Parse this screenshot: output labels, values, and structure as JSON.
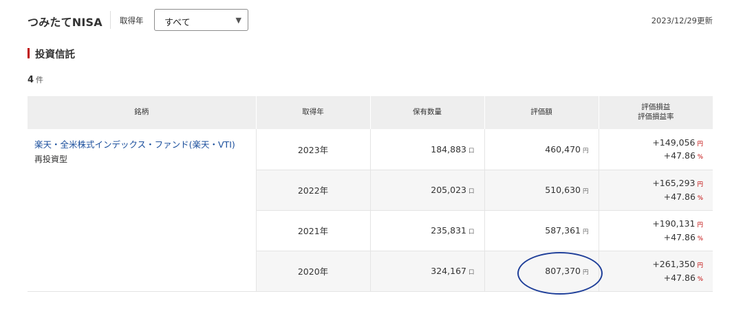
{
  "header": {
    "title": "つみたてNISA",
    "year_label": "取得年",
    "year_select": {
      "value": "すべて",
      "arrow": "▼"
    },
    "updated": "2023/12/29更新"
  },
  "section": {
    "title": "投資信託"
  },
  "count": {
    "value": "4",
    "unit": "件"
  },
  "table": {
    "columns": [
      "銘柄",
      "取得年",
      "保有数量",
      "評価額",
      "評価損益",
      "評価損益率"
    ],
    "fund": {
      "name": "楽天・全米株式インデックス・ファンド(楽天・VTI)",
      "type": "再投資型"
    },
    "units": {
      "quantity": "口",
      "yen": "円",
      "percent": "%"
    },
    "rows": [
      {
        "year": "2023年",
        "quantity": "184,883",
        "value": "460,470",
        "gain": "+149,056",
        "rate": "+47.86"
      },
      {
        "year": "2022年",
        "quantity": "205,023",
        "value": "510,630",
        "gain": "+165,293",
        "rate": "+47.86"
      },
      {
        "year": "2021年",
        "quantity": "235,831",
        "value": "587,361",
        "gain": "+190,131",
        "rate": "+47.86"
      },
      {
        "year": "2020年",
        "quantity": "324,167",
        "value": "807,370",
        "gain": "+261,350",
        "rate": "+47.86"
      }
    ]
  },
  "colors": {
    "accent": "#bf0000",
    "link": "#1a4e9c",
    "annotation": "#1f3f99",
    "header_bg": "#eeeeee",
    "alt_row_bg": "#f6f6f6"
  }
}
